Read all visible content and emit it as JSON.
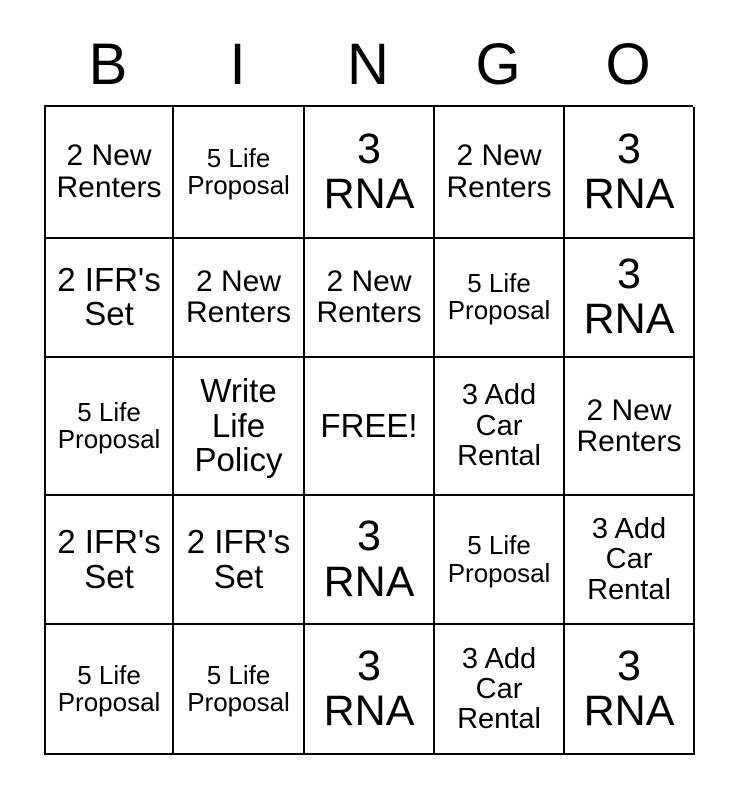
{
  "header": {
    "letters": [
      "B",
      "I",
      "N",
      "G",
      "O"
    ]
  },
  "grid": {
    "rows": [
      [
        {
          "text": "2 New Renters",
          "size": "sz-md"
        },
        {
          "text": "5 Life Proposal",
          "size": "sz-xs"
        },
        {
          "text": "3 RNA",
          "size": "sz-xl"
        },
        {
          "text": "2 New Renters",
          "size": "sz-md"
        },
        {
          "text": "3 RNA",
          "size": "sz-xl"
        }
      ],
      [
        {
          "text": "2 IFR's Set",
          "size": "sz-lg"
        },
        {
          "text": "2 New Renters",
          "size": "sz-md"
        },
        {
          "text": "2 New Renters",
          "size": "sz-md"
        },
        {
          "text": "5 Life Proposal",
          "size": "sz-xs"
        },
        {
          "text": "3 RNA",
          "size": "sz-xl"
        }
      ],
      [
        {
          "text": "5 Life Proposal",
          "size": "sz-xs"
        },
        {
          "text": "Write Life Policy",
          "size": "sz-lg"
        },
        {
          "text": "FREE!",
          "size": "sz-lg"
        },
        {
          "text": "3 Add Car Rental",
          "size": "sz-sm"
        },
        {
          "text": "2 New Renters",
          "size": "sz-md"
        }
      ],
      [
        {
          "text": "2 IFR's Set",
          "size": "sz-lg"
        },
        {
          "text": "2 IFR's Set",
          "size": "sz-lg"
        },
        {
          "text": "3 RNA",
          "size": "sz-xl"
        },
        {
          "text": "5 Life Proposal",
          "size": "sz-xs"
        },
        {
          "text": "3 Add Car Rental",
          "size": "sz-sm"
        }
      ],
      [
        {
          "text": "5 Life Proposal",
          "size": "sz-xs"
        },
        {
          "text": "5 Life Proposal",
          "size": "sz-xs"
        },
        {
          "text": "3 RNA",
          "size": "sz-xl"
        },
        {
          "text": "3 Add Car Rental",
          "size": "sz-sm"
        },
        {
          "text": "3 RNA",
          "size": "sz-xl"
        }
      ]
    ]
  },
  "colors": {
    "ink": "#000000",
    "paper": "#ffffff"
  }
}
